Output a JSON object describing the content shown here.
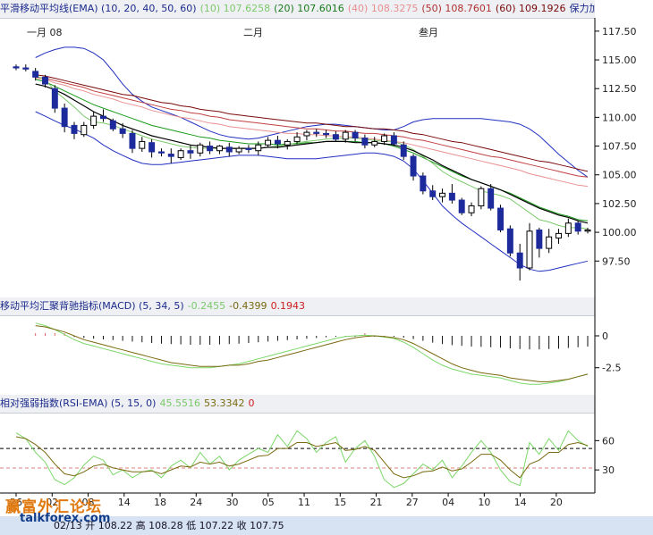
{
  "header_main": {
    "title": "平滑移动平均线(EMA) (10, 20, 40, 50, 60)",
    "e10": "(10) 107.6258",
    "e20": "(20) 107.6016",
    "e40": "(40) 108.3275",
    "e50": "(50) 108.7601",
    "e60": "(60) 109.1926",
    "extra": "保力加通道(BOL"
  },
  "header_macd": {
    "title": "移动平均汇聚背驰指标(MACD) (5, 34, 5)",
    "v1": "-0.2455",
    "v2": "-0.4399",
    "v3": "0.1943"
  },
  "header_rsi": {
    "title": "相对强弱指数(RSI-EMA) (5, 15, 0)",
    "v1": "45.5516",
    "v2": "53.3342",
    "v3": "0"
  },
  "months": [
    "一月 08",
    "二月",
    "叁月"
  ],
  "footer": {
    "text": "02/13 开 108.22 高 108.28 低 107.22 收 107.75"
  },
  "watermark": {
    "cn": "赢富外汇论坛",
    "url": "talkforex.com"
  },
  "colors": {
    "ema10": "#7cc96a",
    "ema20": "#1a9a1a",
    "ema40": "#e89090",
    "ema50": "#c04040",
    "ema60": "#7a0a0a",
    "bollinger": "#2030c0",
    "mid": "#000000",
    "bull_fill": "#ffffff",
    "bear_fill": "#1c2a9c"
  },
  "chart_data": [
    {
      "type": "candlestick",
      "x": [
        "26",
        "02",
        "08",
        "14",
        "18",
        "24",
        "30",
        "05",
        "11",
        "15",
        "21",
        "27",
        "04",
        "10",
        "14",
        "20"
      ],
      "y_ticks": [
        97.5,
        100,
        102.5,
        105,
        107.5,
        110,
        112.5,
        115,
        117.5
      ],
      "ylim": [
        95.5,
        118.5
      ],
      "ohlc": [
        [
          114.4,
          114.6,
          114.1,
          114.3
        ],
        [
          114.3,
          114.6,
          114.0,
          114.2
        ],
        [
          114.0,
          114.3,
          113.2,
          113.5
        ],
        [
          113.5,
          113.7,
          112.6,
          112.9
        ],
        [
          112.5,
          112.8,
          110.4,
          110.8
        ],
        [
          110.8,
          111.2,
          108.7,
          109.2
        ],
        [
          109.3,
          109.6,
          108.1,
          108.6
        ],
        [
          108.5,
          109.6,
          108.3,
          109.3
        ],
        [
          109.3,
          110.5,
          109.0,
          110.1
        ],
        [
          110.1,
          110.7,
          109.6,
          109.9
        ],
        [
          109.7,
          109.9,
          108.8,
          109.0
        ],
        [
          109.0,
          109.5,
          108.2,
          108.6
        ],
        [
          108.6,
          108.9,
          106.9,
          107.3
        ],
        [
          107.3,
          108.3,
          107.0,
          107.9
        ],
        [
          107.8,
          108.1,
          106.5,
          107.0
        ],
        [
          107.0,
          107.3,
          106.6,
          106.9
        ],
        [
          106.8,
          107.3,
          106.0,
          106.6
        ],
        [
          106.5,
          107.3,
          106.3,
          107.1
        ],
        [
          107.1,
          107.6,
          106.4,
          106.9
        ],
        [
          106.9,
          107.8,
          106.6,
          107.6
        ],
        [
          107.5,
          107.9,
          106.8,
          107.1
        ],
        [
          107.1,
          107.6,
          106.8,
          107.5
        ],
        [
          107.4,
          107.8,
          106.6,
          107.0
        ],
        [
          107.0,
          107.5,
          106.8,
          107.3
        ],
        [
          107.3,
          107.6,
          106.9,
          107.2
        ],
        [
          107.1,
          107.9,
          106.7,
          107.6
        ],
        [
          107.6,
          108.3,
          107.4,
          108.0
        ],
        [
          108.0,
          108.4,
          107.3,
          107.7
        ],
        [
          107.6,
          108.1,
          107.2,
          107.9
        ],
        [
          107.9,
          108.7,
          107.7,
          108.3
        ],
        [
          108.4,
          108.9,
          108.0,
          108.7
        ],
        [
          108.7,
          109.0,
          108.3,
          108.6
        ],
        [
          108.6,
          108.9,
          108.2,
          108.5
        ],
        [
          108.5,
          108.8,
          107.9,
          108.1
        ],
        [
          108.1,
          108.9,
          107.8,
          108.7
        ],
        [
          108.7,
          108.9,
          107.9,
          108.2
        ],
        [
          108.2,
          108.5,
          107.3,
          107.6
        ],
        [
          107.6,
          108.3,
          107.4,
          107.9
        ],
        [
          107.9,
          108.6,
          107.6,
          108.4
        ],
        [
          108.4,
          108.7,
          107.5,
          107.7
        ],
        [
          107.6,
          107.9,
          106.3,
          106.6
        ],
        [
          106.6,
          106.8,
          104.5,
          104.9
        ],
        [
          104.9,
          105.2,
          103.3,
          103.6
        ],
        [
          103.6,
          104.1,
          102.8,
          103.1
        ],
        [
          103.1,
          103.8,
          102.6,
          103.4
        ],
        [
          103.4,
          104.2,
          102.5,
          102.8
        ],
        [
          102.8,
          103.0,
          101.5,
          101.7
        ],
        [
          101.7,
          102.6,
          101.4,
          102.3
        ],
        [
          102.3,
          104.0,
          102.0,
          103.8
        ],
        [
          103.8,
          104.2,
          101.9,
          102.1
        ],
        [
          102.1,
          102.4,
          100.0,
          100.2
        ],
        [
          100.3,
          100.6,
          97.9,
          98.2
        ],
        [
          98.2,
          99.0,
          95.8,
          96.9
        ],
        [
          96.9,
          100.8,
          96.7,
          100.1
        ],
        [
          100.2,
          100.4,
          97.8,
          98.6
        ],
        [
          98.6,
          100.3,
          98.2,
          99.6
        ],
        [
          99.5,
          100.3,
          99.0,
          99.9
        ],
        [
          99.9,
          101.2,
          99.6,
          100.8
        ],
        [
          100.8,
          101.0,
          99.8,
          100.1
        ],
        [
          100.1,
          100.4,
          99.9,
          100.2
        ]
      ],
      "ema10": [
        113.6,
        113.3,
        112.3,
        111.6,
        110.9,
        110.1,
        109.6,
        109.5,
        109.3,
        109.0,
        108.7,
        108.4,
        108.1,
        107.9,
        107.7,
        107.5,
        107.4,
        107.3,
        107.3,
        107.3,
        107.3,
        107.3,
        107.3,
        107.3,
        107.4,
        107.5,
        107.6,
        107.8,
        107.9,
        108.0,
        108.1,
        108.2,
        108.2,
        108.2,
        108.1,
        108.0,
        107.9,
        107.9,
        107.6,
        107.2,
        106.6,
        106.0,
        105.3,
        104.8,
        104.4,
        104.0,
        103.6,
        103.4,
        103.2,
        102.9,
        102.3,
        101.7,
        101.1,
        100.9,
        100.6,
        100.4,
        100.4,
        100.3
      ],
      "ema20": [
        113.3,
        113.1,
        112.7,
        112.3,
        111.9,
        111.5,
        111.1,
        110.8,
        110.5,
        110.2,
        109.9,
        109.6,
        109.3,
        109.1,
        108.9,
        108.7,
        108.5,
        108.3,
        108.2,
        108.0,
        107.9,
        107.8,
        107.7,
        107.7,
        107.7,
        107.6,
        107.7,
        107.7,
        107.8,
        107.8,
        107.9,
        107.9,
        107.9,
        107.9,
        107.8,
        107.8,
        107.7,
        107.5,
        107.2,
        106.9,
        106.5,
        106.1,
        105.7,
        105.3,
        104.9,
        104.6,
        104.3,
        104.0,
        103.7,
        103.4,
        103.0,
        102.6,
        102.2,
        101.9,
        101.6,
        101.4,
        101.1,
        101.0
      ],
      "ema40": [
        113.4,
        113.3,
        113.0,
        112.8,
        112.5,
        112.3,
        112.0,
        111.8,
        111.6,
        111.3,
        111.1,
        110.9,
        110.6,
        110.4,
        110.2,
        110.0,
        109.9,
        109.7,
        109.5,
        109.4,
        109.2,
        109.1,
        109.0,
        108.9,
        108.8,
        108.7,
        108.6,
        108.6,
        108.5,
        108.5,
        108.4,
        108.4,
        108.3,
        108.3,
        108.2,
        108.1,
        108.0,
        107.9,
        107.8,
        107.6,
        107.4,
        107.2,
        107.0,
        106.8,
        106.6,
        106.4,
        106.2,
        106.0,
        105.8,
        105.6,
        105.4,
        105.1,
        104.9,
        104.7,
        104.5,
        104.3,
        104.1,
        104.0
      ],
      "ema50": [
        113.5,
        113.4,
        113.2,
        113.0,
        112.8,
        112.6,
        112.3,
        112.1,
        111.9,
        111.7,
        111.5,
        111.3,
        111.1,
        110.9,
        110.7,
        110.6,
        110.4,
        110.3,
        110.1,
        110.0,
        109.8,
        109.7,
        109.6,
        109.5,
        109.4,
        109.3,
        109.2,
        109.1,
        109.0,
        109.0,
        108.9,
        108.8,
        108.8,
        108.7,
        108.6,
        108.6,
        108.5,
        108.4,
        108.3,
        108.1,
        108.0,
        107.8,
        107.6,
        107.4,
        107.2,
        107.0,
        106.8,
        106.6,
        106.5,
        106.3,
        106.1,
        105.9,
        105.7,
        105.5,
        105.3,
        105.1,
        104.9,
        104.8
      ],
      "ema60": [
        113.7,
        113.6,
        113.4,
        113.2,
        113.0,
        112.8,
        112.6,
        112.4,
        112.2,
        112.0,
        111.9,
        111.7,
        111.5,
        111.3,
        111.2,
        111.0,
        110.9,
        110.7,
        110.6,
        110.5,
        110.3,
        110.2,
        110.1,
        110.0,
        109.9,
        109.8,
        109.7,
        109.6,
        109.5,
        109.5,
        109.4,
        109.3,
        109.2,
        109.2,
        109.1,
        109.0,
        109.0,
        108.9,
        108.8,
        108.6,
        108.5,
        108.3,
        108.1,
        107.9,
        107.8,
        107.6,
        107.4,
        107.2,
        107.0,
        106.8,
        106.6,
        106.4,
        106.2,
        106.1,
        105.9,
        105.7,
        105.5,
        105.3
      ],
      "mid": [
        112.9,
        112.7,
        112.4,
        112.0,
        111.5,
        111.0,
        110.5,
        110.1,
        109.7,
        109.3,
        109.0,
        108.7,
        108.4,
        108.2,
        108.0,
        107.8,
        107.6,
        107.5,
        107.4,
        107.3,
        107.3,
        107.3,
        107.3,
        107.3,
        107.4,
        107.4,
        107.5,
        107.6,
        107.7,
        107.8,
        107.9,
        107.9,
        107.9,
        107.8,
        107.8,
        107.8,
        107.7,
        107.6,
        107.4,
        107.1,
        106.7,
        106.3,
        105.8,
        105.4,
        105.0,
        104.6,
        104.3,
        104.0,
        103.7,
        103.3,
        102.9,
        102.5,
        102.1,
        101.8,
        101.5,
        101.3,
        101.0,
        100.8
      ],
      "boll_upper": [
        115.2,
        115.6,
        115.9,
        116.1,
        116.1,
        116.0,
        115.6,
        115.0,
        114.0,
        112.9,
        112.0,
        111.4,
        110.9,
        110.6,
        110.3,
        110.0,
        109.6,
        109.2,
        108.8,
        108.5,
        108.3,
        108.2,
        108.1,
        108.2,
        108.4,
        108.6,
        108.8,
        109.0,
        109.2,
        109.3,
        109.4,
        109.4,
        109.3,
        109.2,
        109.1,
        109.0,
        108.9,
        108.9,
        109.2,
        109.6,
        109.8,
        109.9,
        109.9,
        109.9,
        109.9,
        109.9,
        109.9,
        109.8,
        109.7,
        109.6,
        109.4,
        109.0,
        108.4,
        107.6,
        106.8,
        106.1,
        105.4,
        104.8
      ],
      "boll_lower": [
        110.5,
        110.1,
        109.7,
        109.3,
        109.0,
        108.6,
        108.2,
        107.6,
        107.1,
        106.7,
        106.3,
        106.0,
        105.9,
        105.9,
        106.0,
        106.1,
        106.2,
        106.3,
        106.4,
        106.5,
        106.6,
        106.7,
        106.7,
        106.7,
        106.6,
        106.5,
        106.4,
        106.4,
        106.4,
        106.4,
        106.5,
        106.6,
        106.7,
        106.8,
        106.9,
        106.9,
        106.8,
        106.6,
        106.2,
        105.5,
        104.5,
        103.4,
        102.3,
        101.5,
        100.8,
        100.2,
        99.6,
        99.0,
        98.4,
        97.8,
        97.2,
        96.8,
        96.6,
        96.7,
        96.9,
        97.1,
        97.3,
        97.5
      ]
    },
    {
      "type": "line",
      "name": "MACD",
      "y_ticks": [
        0,
        -2.5
      ],
      "ylim": [
        -4.2,
        1.4
      ],
      "macd": [
        1.0,
        0.8,
        0.5,
        0.1,
        -0.3,
        -0.6,
        -0.8,
        -1.0,
        -1.2,
        -1.4,
        -1.6,
        -1.8,
        -2.0,
        -2.2,
        -2.3,
        -2.4,
        -2.5,
        -2.5,
        -2.5,
        -2.4,
        -2.3,
        -2.2,
        -2.0,
        -1.8,
        -1.6,
        -1.4,
        -1.2,
        -1.0,
        -0.8,
        -0.6,
        -0.4,
        -0.2,
        -0.05,
        0.0,
        0.05,
        0.0,
        -0.1,
        -0.2,
        -0.5,
        -0.9,
        -1.4,
        -1.9,
        -2.3,
        -2.6,
        -2.8,
        -3.0,
        -3.1,
        -3.2,
        -3.3,
        -3.5,
        -3.7,
        -3.8,
        -3.8,
        -3.7,
        -3.6,
        -3.4,
        -3.2,
        -3.0
      ],
      "signal": [
        0.8,
        0.7,
        0.5,
        0.3,
        0.0,
        -0.3,
        -0.5,
        -0.7,
        -0.9,
        -1.1,
        -1.3,
        -1.5,
        -1.7,
        -1.9,
        -2.1,
        -2.2,
        -2.3,
        -2.4,
        -2.4,
        -2.4,
        -2.3,
        -2.3,
        -2.2,
        -2.0,
        -1.9,
        -1.7,
        -1.5,
        -1.3,
        -1.1,
        -0.9,
        -0.7,
        -0.5,
        -0.3,
        -0.15,
        -0.05,
        0.0,
        -0.05,
        -0.15,
        -0.3,
        -0.6,
        -1.0,
        -1.4,
        -1.8,
        -2.2,
        -2.5,
        -2.7,
        -2.9,
        -3.0,
        -3.1,
        -3.3,
        -3.4,
        -3.5,
        -3.6,
        -3.6,
        -3.5,
        -3.4,
        -3.2,
        -3.0
      ]
    },
    {
      "type": "line",
      "name": "RSI-EMA",
      "y_ticks": [
        60,
        30
      ],
      "ylim": [
        10,
        85
      ],
      "levels": [
        52,
        32
      ],
      "rsi": [
        68,
        62,
        48,
        38,
        20,
        15,
        22,
        35,
        44,
        40,
        25,
        30,
        22,
        28,
        30,
        22,
        34,
        40,
        32,
        48,
        36,
        44,
        30,
        40,
        46,
        52,
        48,
        66,
        54,
        70,
        62,
        48,
        58,
        64,
        38,
        52,
        60,
        44,
        20,
        12,
        16,
        26,
        36,
        30,
        40,
        22,
        34,
        48,
        60,
        48,
        30,
        18,
        14,
        58,
        46,
        62,
        50,
        70,
        60,
        54
      ],
      "rsi_ema": [
        64,
        62,
        56,
        48,
        36,
        26,
        24,
        28,
        34,
        36,
        32,
        30,
        28,
        28,
        29,
        26,
        30,
        34,
        33,
        38,
        36,
        38,
        34,
        36,
        40,
        44,
        45,
        52,
        52,
        58,
        58,
        54,
        56,
        58,
        50,
        51,
        54,
        50,
        38,
        26,
        22,
        24,
        28,
        29,
        33,
        29,
        31,
        38,
        46,
        46,
        40,
        30,
        22,
        36,
        40,
        48,
        48,
        56,
        58,
        55
      ]
    }
  ]
}
